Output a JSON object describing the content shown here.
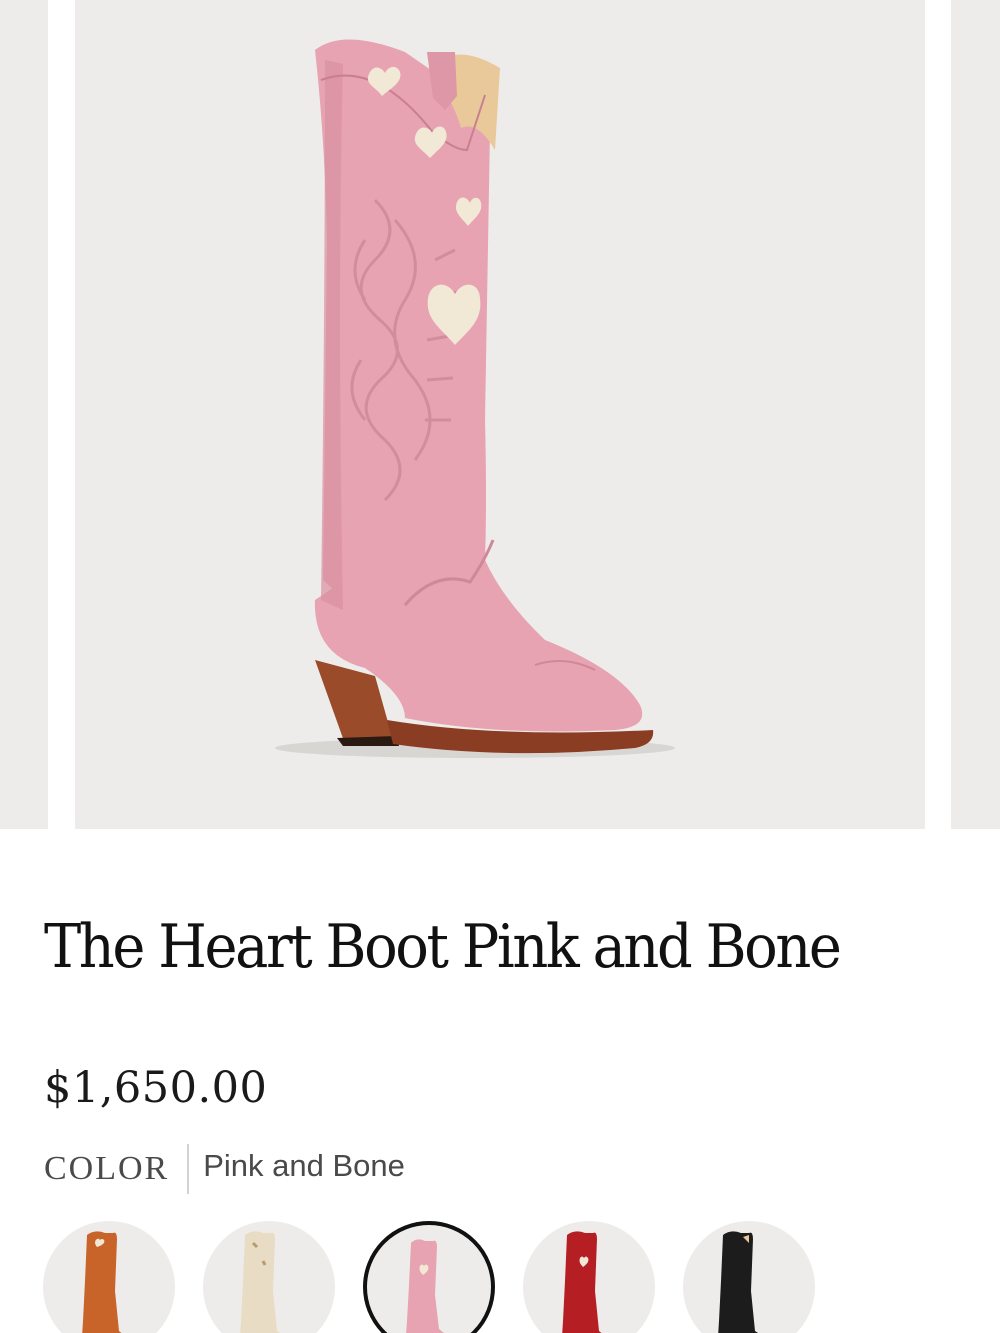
{
  "product": {
    "title": "The Heart Boot Pink and Bone",
    "price": "$1,650.00",
    "color_label": "COLOR",
    "selected_color": "Pink and Bone"
  },
  "swatches": [
    {
      "name": "orange",
      "color": "#c8642a",
      "selected": false
    },
    {
      "name": "bone",
      "color": "#e8dcc4",
      "selected": false
    },
    {
      "name": "pink",
      "color": "#e5a6b4",
      "selected": true
    },
    {
      "name": "red",
      "color": "#b51f24",
      "selected": false
    },
    {
      "name": "black",
      "color": "#1c1c1c",
      "selected": false
    }
  ],
  "colors": {
    "boot_pink": "#e7a3b1",
    "heart_bone": "#f1e8d6",
    "heel_brown": "#9a4b2a",
    "background": "#edecea"
  }
}
